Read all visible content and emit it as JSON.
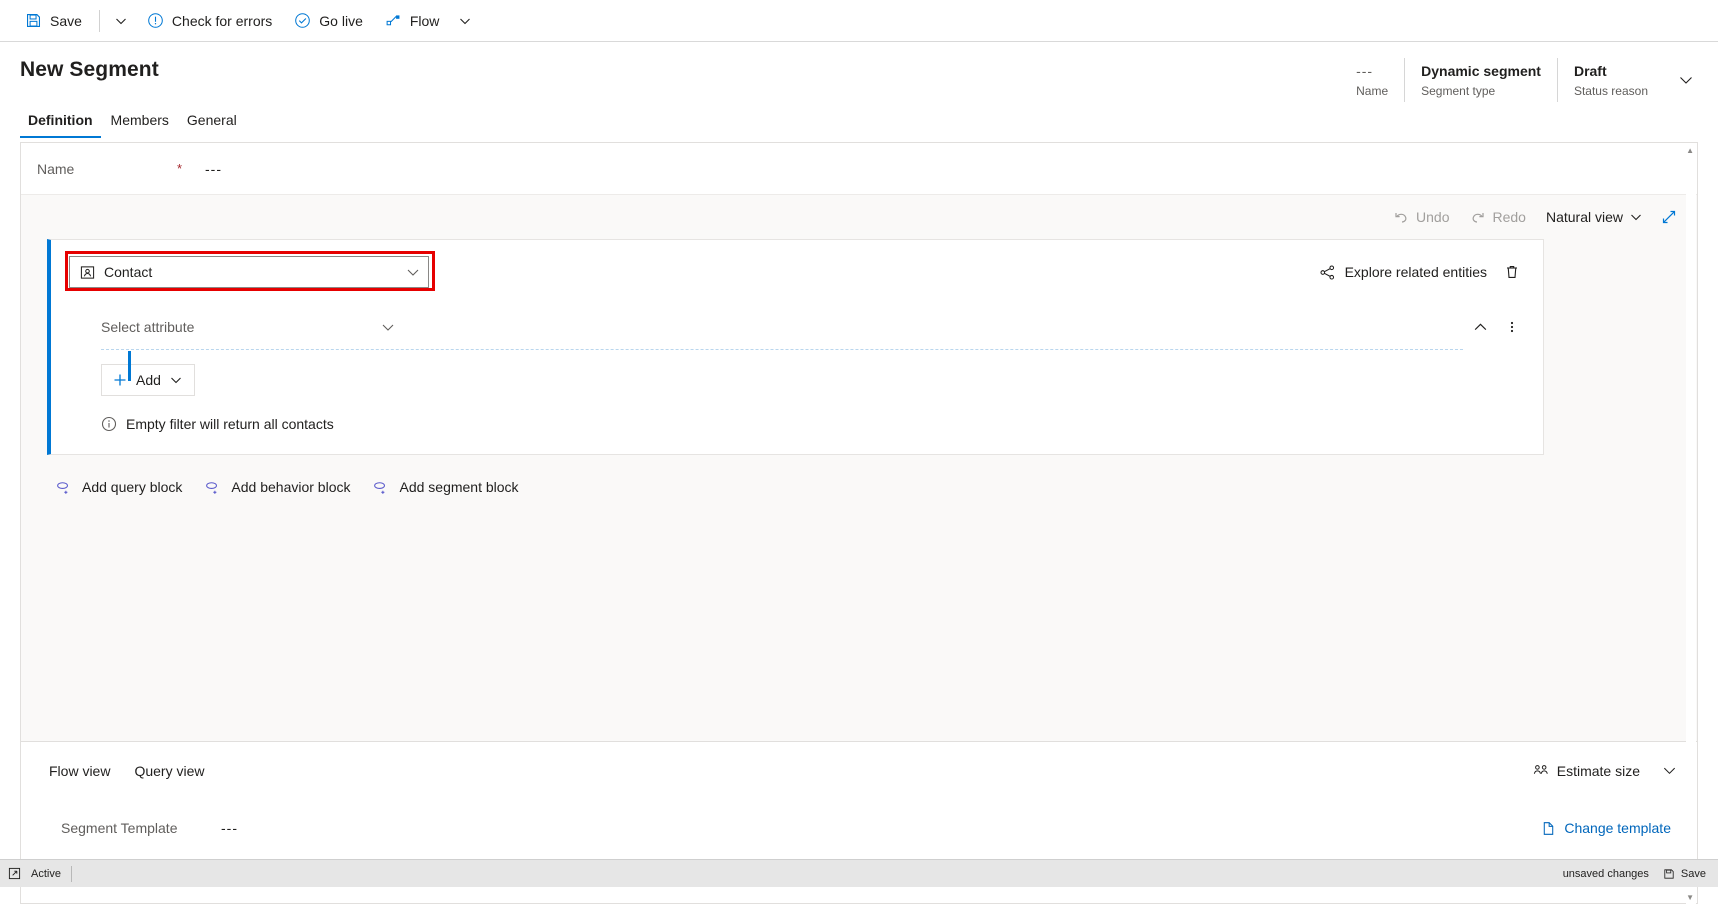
{
  "commandbar": {
    "save_label": "Save",
    "save_icon": "save-disk-icon",
    "save_caret_icon": "chevron-down-icon",
    "check_errors_label": "Check for errors",
    "check_errors_icon": "exclamation-circle-icon",
    "go_live_label": "Go live",
    "go_live_icon": "check-circle-icon",
    "flow_label": "Flow",
    "flow_icon": "flow-icon",
    "flow_caret_icon": "chevron-down-icon"
  },
  "header": {
    "title": "New Segment",
    "meta": [
      {
        "value": "---",
        "label": "Name",
        "dim": true
      },
      {
        "value": "Dynamic segment",
        "label": "Segment type",
        "dim": false
      },
      {
        "value": "Draft",
        "label": "Status reason",
        "dim": false
      }
    ],
    "expand_icon": "chevron-down-icon"
  },
  "tabs": [
    {
      "label": "Definition",
      "active": true
    },
    {
      "label": "Members",
      "active": false
    },
    {
      "label": "General",
      "active": false
    }
  ],
  "form": {
    "name_label": "Name",
    "name_required_mark": "*",
    "name_value": "---"
  },
  "builder": {
    "toolbar": {
      "undo_label": "Undo",
      "undo_icon": "undo-arrow-icon",
      "redo_label": "Redo",
      "redo_icon": "redo-arrow-icon",
      "view_mode_label": "Natural view",
      "view_mode_caret_icon": "chevron-down-icon",
      "expand_icon": "expand-diagonal-icon"
    },
    "query_block": {
      "entity_icon": "contact-entity-icon",
      "entity_value": "Contact",
      "entity_caret_icon": "chevron-down-icon",
      "explore_label": "Explore related entities",
      "explore_icon": "share-nodes-icon",
      "delete_icon": "trash-icon",
      "attribute_placeholder": "Select attribute",
      "attribute_caret_icon": "chevron-down-icon",
      "collapse_icon": "chevron-up-icon",
      "more_icon": "ellipsis-vertical-icon",
      "add_label": "Add",
      "add_icon": "plus-icon",
      "add_caret_icon": "chevron-down-icon",
      "info_text": "Empty filter will return all contacts",
      "info_icon": "info-circle-icon"
    },
    "block_links": [
      {
        "label": "Add query block",
        "icon": "add-query-block-icon"
      },
      {
        "label": "Add behavior block",
        "icon": "add-behavior-block-icon"
      },
      {
        "label": "Add segment block",
        "icon": "add-segment-block-icon"
      }
    ]
  },
  "footer": {
    "view_tabs": [
      {
        "label": "Flow view"
      },
      {
        "label": "Query view"
      }
    ],
    "estimate_label": "Estimate size",
    "estimate_icon": "people-icon",
    "estimate_caret_icon": "chevron-down-icon",
    "template_label": "Segment Template",
    "template_value": "---",
    "change_template_label": "Change template",
    "change_template_icon": "document-icon"
  },
  "statusbar": {
    "resize_icon": "resize-icon",
    "state_label": "Active",
    "unsaved_label": "unsaved changes",
    "save_label": "Save",
    "save_icon": "save-disk-icon"
  },
  "colors": {
    "accent": "#0078d4",
    "highlight_outline": "#e60000",
    "required": "#a4262c",
    "link": "#0066bb",
    "canvas": "#faf9f8",
    "statusbar": "#e6e6e6"
  }
}
